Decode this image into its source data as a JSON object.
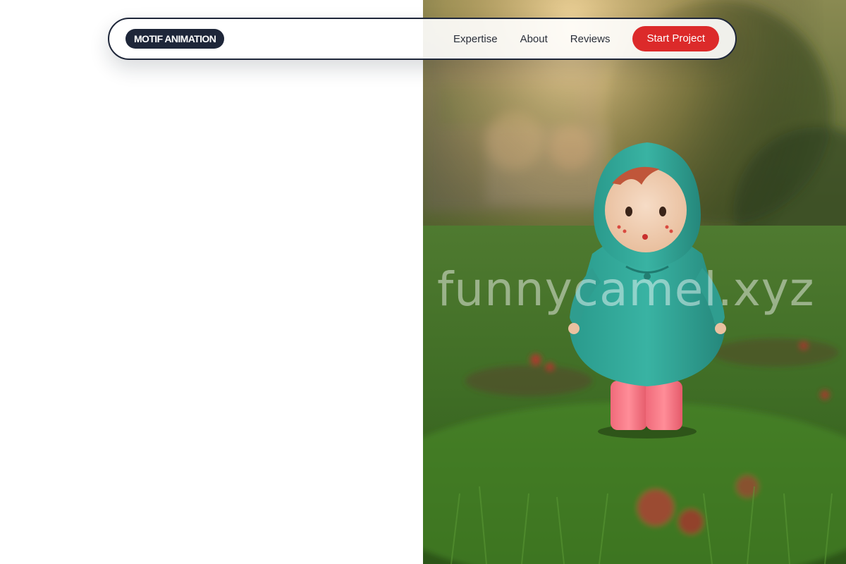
{
  "brand": {
    "label": "MOTIF ANIMATION"
  },
  "nav": {
    "links": [
      {
        "label": "Expertise"
      },
      {
        "label": "About"
      },
      {
        "label": "Reviews"
      }
    ],
    "cta_label": "Start Project"
  },
  "hero": {
    "image_icon": "figurine-in-grass-photo",
    "watermark": "funnycamel.xyz"
  },
  "colors": {
    "navy": "#1e2639",
    "accent_red": "#dc2a2a",
    "white": "#ffffff"
  }
}
